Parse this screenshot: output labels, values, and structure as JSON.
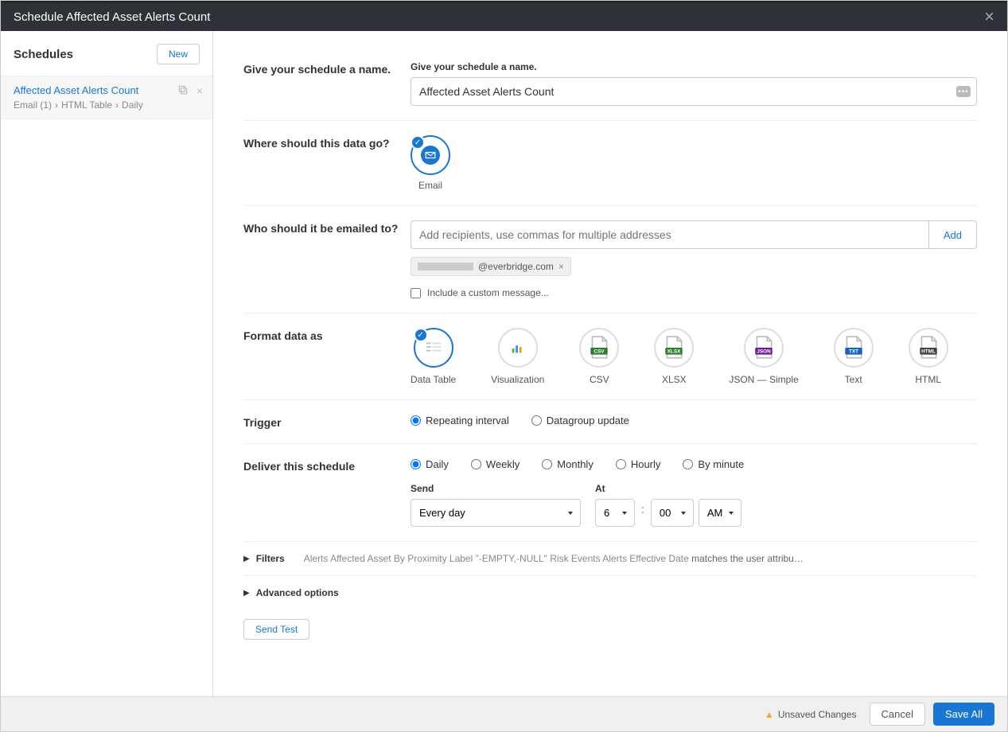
{
  "modal": {
    "title": "Schedule Affected Asset Alerts Count"
  },
  "sidebar": {
    "heading": "Schedules",
    "new_btn": "New",
    "item": {
      "title": "Affected Asset Alerts Count",
      "crumb1": "Email (1)",
      "crumb2": "HTML Table",
      "crumb3": "Daily"
    }
  },
  "name_section": {
    "label": "Give your schedule a name.",
    "field_label": "Give your schedule a name.",
    "value": "Affected Asset Alerts Count"
  },
  "dest_section": {
    "label": "Where should this data go?",
    "email_label": "Email"
  },
  "recip_section": {
    "label": "Who should it be emailed to?",
    "placeholder": "Add recipients, use commas for multiple addresses",
    "add_btn": "Add",
    "chip_domain": "@everbridge.com",
    "custom_msg": "Include a custom message..."
  },
  "format_section": {
    "label": "Format data as",
    "options": [
      "Data Table",
      "Visualization",
      "CSV",
      "XLSX",
      "JSON — Simple",
      "Text",
      "HTML"
    ],
    "badges": [
      "",
      "",
      "CSV",
      "XLSX",
      "JSON",
      "TXT",
      "HTML"
    ]
  },
  "trigger_section": {
    "label": "Trigger",
    "opt1": "Repeating interval",
    "opt2": "Datagroup update"
  },
  "deliver_section": {
    "label": "Deliver this schedule",
    "freq": [
      "Daily",
      "Weekly",
      "Monthly",
      "Hourly",
      "By minute"
    ],
    "send_label": "Send",
    "send_value": "Every day",
    "at_label": "At",
    "hour": "6",
    "minute": "00",
    "ampm": "AM"
  },
  "filters": {
    "label": "Filters",
    "detail_prefix": "Alerts Affected Asset By Proximity Label \"-EMPTY,-NULL\" Risk Events Alerts Effective Date ",
    "detail_suffix": "matches the user attribu…"
  },
  "advanced": {
    "label": "Advanced options"
  },
  "send_test": "Send Test",
  "footer": {
    "unsaved": "Unsaved Changes",
    "cancel": "Cancel",
    "save": "Save All"
  }
}
